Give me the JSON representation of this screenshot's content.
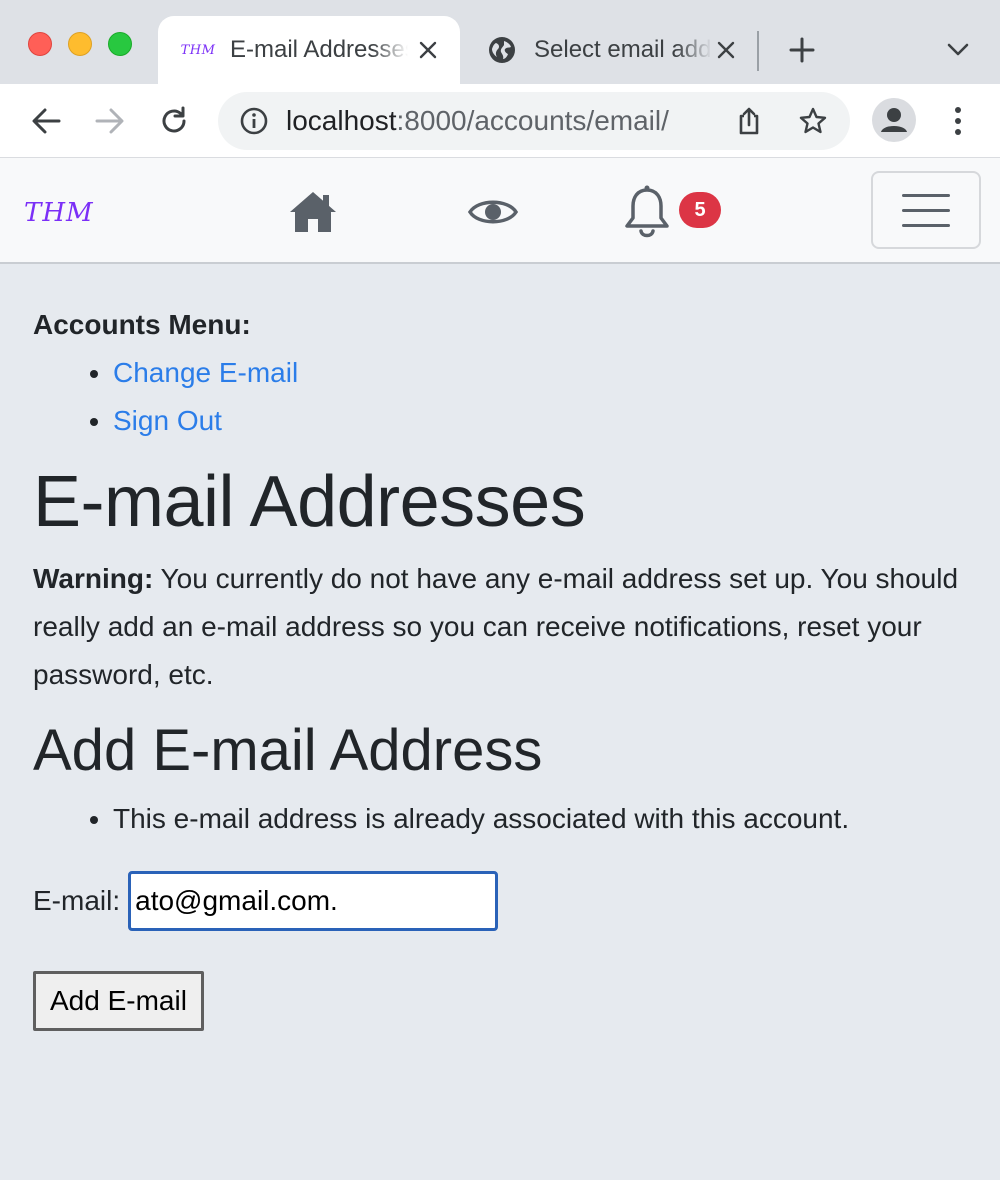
{
  "browser": {
    "tabs": [
      {
        "title": "E-mail Addresses",
        "favicon_text": "THM",
        "active": true
      },
      {
        "title": "Select email address",
        "favicon": "globe-icon",
        "active": false
      }
    ],
    "address_bar": {
      "host": "localhost",
      "rest": ":8000/accounts/email/"
    }
  },
  "navbar": {
    "brand": "THM",
    "notification_count": "5",
    "icons": [
      "home-icon",
      "eye-icon",
      "bell-icon",
      "hamburger-menu-icon"
    ]
  },
  "accounts_menu": {
    "title": "Accounts Menu:",
    "links": [
      {
        "label": "Change E-mail"
      },
      {
        "label": "Sign Out"
      }
    ]
  },
  "page": {
    "heading": "E-mail Addresses",
    "warning_label": "Warning:",
    "warning_text": " You currently do not have any e-mail address set up. You should really add an e-mail address so you can receive notifications, reset your password, etc.",
    "add_heading": "Add E-mail Address",
    "errors": [
      "This e-mail address is already associated with this account."
    ],
    "email_label": "E-mail:",
    "email_value": "ato@gmail.com.",
    "submit_label": "Add E-mail"
  },
  "colors": {
    "link": "#2b7de9",
    "badge": "#dc3545",
    "brand": "#7b2ff7",
    "page_bg": "#e6eaef"
  }
}
